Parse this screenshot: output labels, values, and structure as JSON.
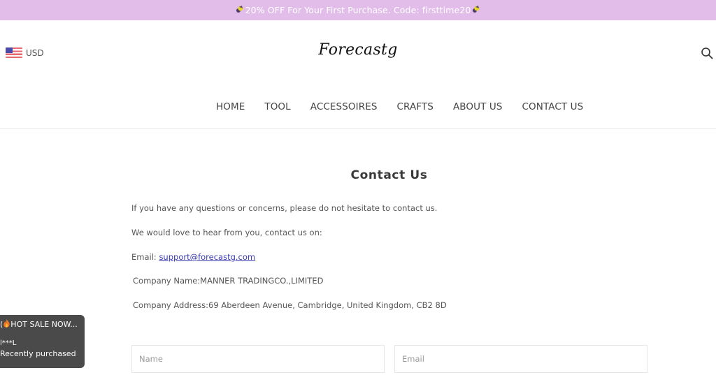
{
  "announcement": {
    "icon_left": "bee-icon",
    "text": "20% OFF For Your First Purchase. Code: firsttime20",
    "icon_right": "bee-icon",
    "background": "#e2bdea"
  },
  "header": {
    "currency": {
      "flag": "us-flag-icon",
      "label": "USD"
    },
    "logo": "Forecastg",
    "search_icon": "search-icon"
  },
  "nav": {
    "items": [
      {
        "label": "HOME"
      },
      {
        "label": "TOOL"
      },
      {
        "label": "ACCESSOIRES"
      },
      {
        "label": "CRAFTS"
      },
      {
        "label": "ABOUT US"
      },
      {
        "label": "CONTACT US"
      }
    ]
  },
  "main": {
    "title": "Contact Us",
    "intro": "If you have any questions or concerns, please do not hesitate to contact us.",
    "love_line": "We would love to hear from you, contact us on:",
    "email_label": "Email: ",
    "email_value": "support@forecastg.com",
    "company_name": "Company Name:MANNER TRADINGCO.,LIMITED",
    "company_address": "Company Address:69 Aberdeen Avenue, Cambridge, United Kingdom, CB2 8D",
    "form": {
      "name_placeholder": "Name",
      "email_placeholder": "Email"
    },
    "link_color": "#3a3ab0"
  },
  "popup": {
    "prefix": "(",
    "icon": "fire-icon",
    "headline": "HOT SALE NOW...",
    "buyer": "l***L",
    "status": "Recently purchased"
  }
}
